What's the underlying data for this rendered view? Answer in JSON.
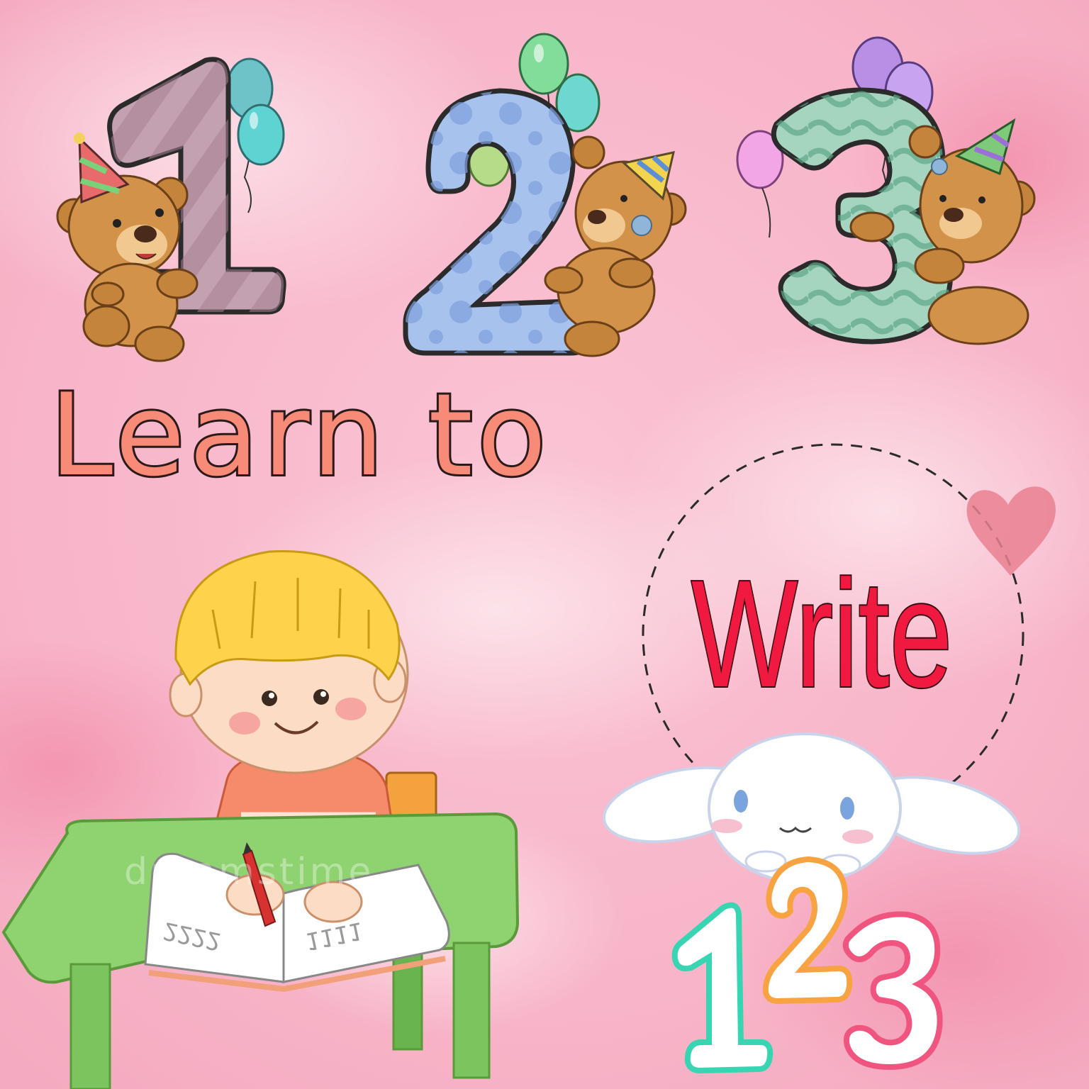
{
  "numerals_top": [
    "1",
    "2",
    "3"
  ],
  "title_learn": "Learn to",
  "title_write": "Write",
  "numerals_bottom": [
    "1",
    "2",
    "3"
  ],
  "book_marks_left": "2222",
  "book_marks_right": "1111",
  "watermark": "dreamstime",
  "colors": {
    "background": "#f8b9cc",
    "learn_to": "#f88a78",
    "write": "#f0193f",
    "numeral_1": "#bd98a8",
    "numeral_2": "#a8c2ee",
    "numeral_3": "#a5d5bf",
    "heart": "#e98090",
    "table": "#8fd370",
    "shirt": "#f68b6b",
    "hair": "#ffd24c"
  },
  "icons": [
    "teddy-bear-icon",
    "balloon-icon",
    "party-hat-icon",
    "heart-icon",
    "bunny-mascot-icon",
    "crayon-icon"
  ]
}
